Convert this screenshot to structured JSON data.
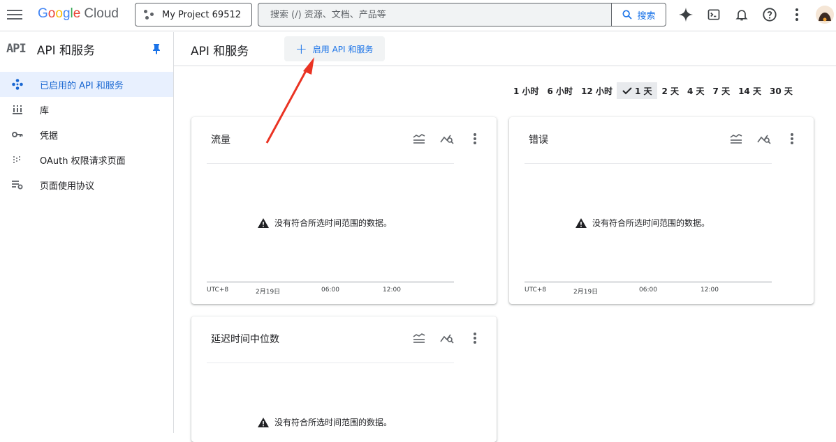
{
  "header": {
    "logo_letters": [
      "G",
      "o",
      "o",
      "g",
      "l",
      "e"
    ],
    "logo_cloud": "Cloud",
    "project_name": "My Project 69512",
    "search_placeholder": "搜索 (/) 资源、文档、产品等",
    "search_button": "搜索",
    "icons": [
      "gemini-sparkle-icon",
      "cloud-shell-icon",
      "notifications-icon",
      "help-icon",
      "more-vert-icon",
      "avatar"
    ]
  },
  "sidebar": {
    "mark": "API",
    "title": "API 和服务",
    "items": [
      {
        "label": "已启用的 API 和服务",
        "icon": "diamond-nodes-icon",
        "active": true
      },
      {
        "label": "库",
        "icon": "library-icon",
        "active": false
      },
      {
        "label": "凭据",
        "icon": "key-icon",
        "active": false
      },
      {
        "label": "OAuth 权限请求页面",
        "icon": "consent-icon",
        "active": false
      },
      {
        "label": "页面使用协议",
        "icon": "settings-list-icon",
        "active": false
      }
    ]
  },
  "main": {
    "title": "API 和服务",
    "enable_button": "启用 API 和服务",
    "time_ranges": [
      "1 小时",
      "6 小时",
      "12 小时",
      "1 天",
      "2 天",
      "4 天",
      "7 天",
      "14 天",
      "30 天"
    ],
    "selected_time_range": "1 天",
    "cards": [
      {
        "title": "流量",
        "message": "没有符合所选时间范围的数据。",
        "axis": [
          "UTC+8",
          "2月19日",
          "06:00",
          "12:00"
        ]
      },
      {
        "title": "错误",
        "message": "没有符合所选时间范围的数据。",
        "axis": [
          "UTC+8",
          "2月19日",
          "06:00",
          "12:00"
        ]
      },
      {
        "title": "延迟时间中位数",
        "message": "没有符合所选时间范围的数据。",
        "axis": []
      }
    ]
  },
  "colors": {
    "accent": "#1a73e8",
    "active_bg": "#e8f0fe",
    "annotation_arrow": "#ea3323"
  }
}
